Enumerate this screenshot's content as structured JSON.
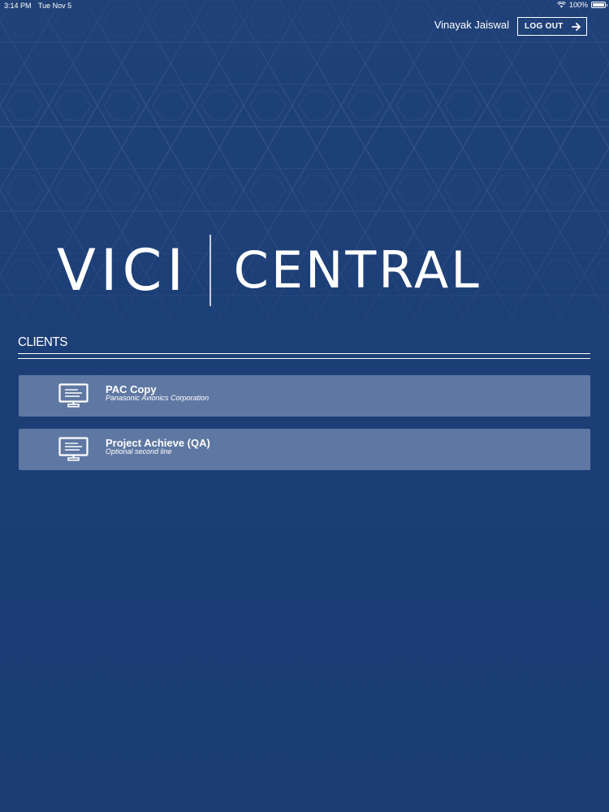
{
  "status_bar": {
    "time": "3:14 PM",
    "date": "Tue Nov 5",
    "battery": "100%"
  },
  "header": {
    "user_name": "Vinayak Jaiswal",
    "logout_label": "LOG OUT"
  },
  "logo": {
    "left": "VICI",
    "right": "CENTRAL"
  },
  "clients": {
    "section_title": "CLIENTS",
    "items": [
      {
        "title": "PAC Copy",
        "subtitle": "Panasonic Avionics Corporation",
        "icon": "monitor-icon"
      },
      {
        "title": "Project Achieve (QA)",
        "subtitle": "Optional second line",
        "icon": "monitor-icon"
      }
    ]
  },
  "colors": {
    "background": "#1f4178",
    "list_item": "#5f78a3",
    "text": "#ffffff"
  }
}
